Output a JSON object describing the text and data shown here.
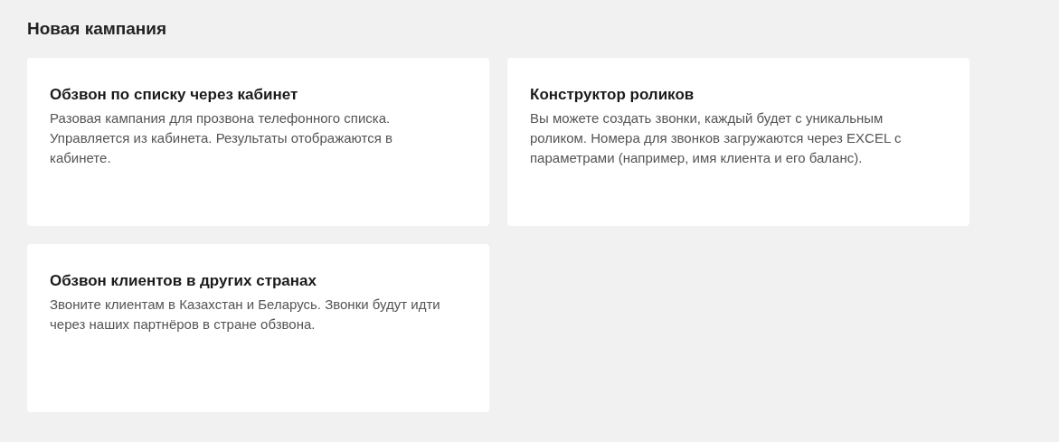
{
  "title": "Новая кампания",
  "cards": [
    {
      "title": "Обзвон по списку через кабинет",
      "description": "Разовая кампания для прозвона телефонного списка. Управляется из кабинета. Результаты отображаются в кабинете."
    },
    {
      "title": "Конструктор роликов",
      "description": "Вы можете создать звонки, каждый будет с уникальным роликом. Номера для звонков загружаются через EXCEL с параметрами (например, имя клиента и его баланс)."
    },
    {
      "title": "Обзвон клиентов в других странах",
      "description": "Звоните клиентам в Казахстан и Беларусь. Звонки будут идти через наших партнёров в стране обзвона."
    }
  ]
}
